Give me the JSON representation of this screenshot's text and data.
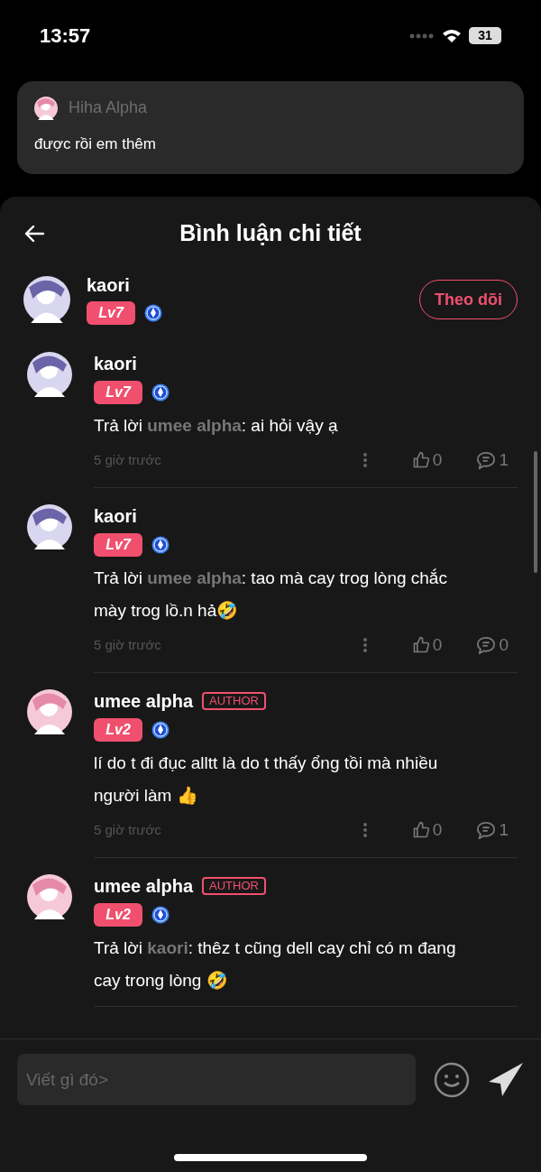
{
  "status_bar": {
    "time": "13:57",
    "battery": "31"
  },
  "notification": {
    "sender": "Hiha Alpha",
    "message": "được rồi em thêm"
  },
  "header": {
    "title": "Bình luận chi tiết"
  },
  "author": {
    "name": "kaori",
    "level": "Lv7",
    "follow_label": "Theo dõi"
  },
  "comments": [
    {
      "name": "kaori",
      "author_tag": false,
      "level": "Lv7",
      "reply_prefix": "Trả lời",
      "reply_to": "umee alpha",
      "text": ": ai hỏi vậy ạ",
      "time": "5 giờ trước",
      "likes": "0",
      "replies": "1"
    },
    {
      "name": "kaori",
      "author_tag": false,
      "level": "Lv7",
      "reply_prefix": "Trả lời",
      "reply_to": "umee alpha",
      "text": ": tao mà cay trog lòng chắc mày trog lồ.n hả🤣",
      "time": "5 giờ trước",
      "likes": "0",
      "replies": "0"
    },
    {
      "name": "umee alpha",
      "author_tag": true,
      "author_label": "AUTHOR",
      "level": "Lv2",
      "text": "lí do t đi đục alltt là do t thấy ổng tồi mà nhiều người làm 👍",
      "time": "5 giờ trước",
      "likes": "0",
      "replies": "1"
    },
    {
      "name": "umee alpha",
      "author_tag": true,
      "author_label": "AUTHOR",
      "level": "Lv2",
      "reply_prefix": "Trả lời",
      "reply_to": "kaori",
      "text": ": thêz t cũng dell cay chỉ có m đang cay trong lòng 🤣"
    }
  ],
  "composer": {
    "placeholder": "Viết gì đó>"
  }
}
